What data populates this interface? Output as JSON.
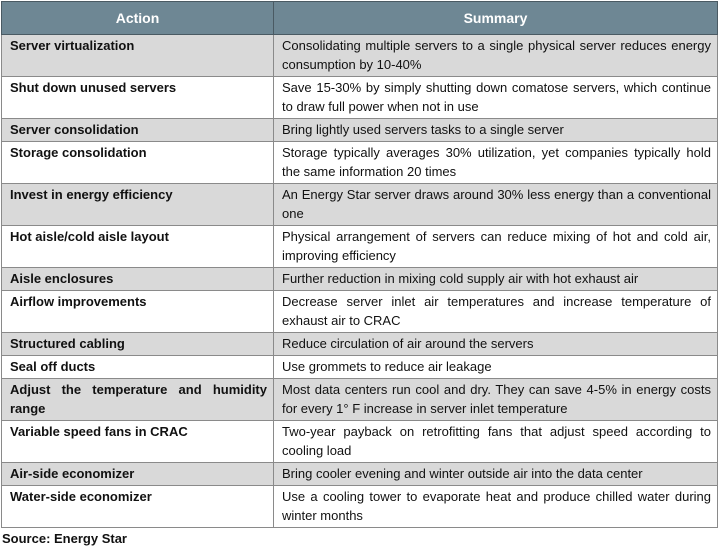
{
  "table": {
    "headers": [
      "Action",
      "Summary"
    ],
    "rows": [
      {
        "action": "Server virtualization",
        "summary": "Consolidating multiple servers to a single physical server reduces energy consumption by 10-40%"
      },
      {
        "action": "Shut down unused servers",
        "summary": "Save 15-30% by simply shutting down comatose servers, which continue to draw full power when not in use"
      },
      {
        "action": "Server consolidation",
        "summary": "Bring lightly used servers tasks to a single server"
      },
      {
        "action": "Storage consolidation",
        "summary": "Storage typically averages 30% utilization, yet companies typically hold the same information 20 times"
      },
      {
        "action": "Invest in energy efficiency",
        "summary": "An Energy Star server draws around 30% less energy than a conventional one"
      },
      {
        "action": "Hot aisle/cold aisle layout",
        "summary": "Physical arrangement of servers can reduce mixing of hot and cold air, improving efficiency"
      },
      {
        "action": "Aisle enclosures",
        "summary": "Further reduction in mixing cold supply air with hot exhaust air"
      },
      {
        "action": "Airflow improvements",
        "summary": "Decrease server inlet air temperatures and increase temperature of exhaust air to CRAC"
      },
      {
        "action": "Structured cabling",
        "summary": "Reduce circulation of air around the servers"
      },
      {
        "action": "Seal off ducts",
        "summary": "Use grommets to reduce air leakage"
      },
      {
        "action": "Adjust the temperature and humidity range",
        "summary": "Most data centers run cool and dry. They can save 4-5% in energy costs for every 1° F increase in server inlet temperature"
      },
      {
        "action": "Variable speed fans in CRAC",
        "summary": "Two-year payback on retrofitting fans that adjust speed according to cooling load"
      },
      {
        "action": "Air-side economizer",
        "summary": "Bring cooler evening and winter outside air into the data center"
      },
      {
        "action": "Water-side economizer",
        "summary": "Use a cooling tower to evaporate heat and produce chilled water during winter months"
      }
    ]
  },
  "footer": {
    "source_text": "Source: Energy Star"
  },
  "colors": {
    "header_bg": "#6e8794",
    "header_text": "#ffffff",
    "shaded_row_bg": "#d9d9d9"
  }
}
